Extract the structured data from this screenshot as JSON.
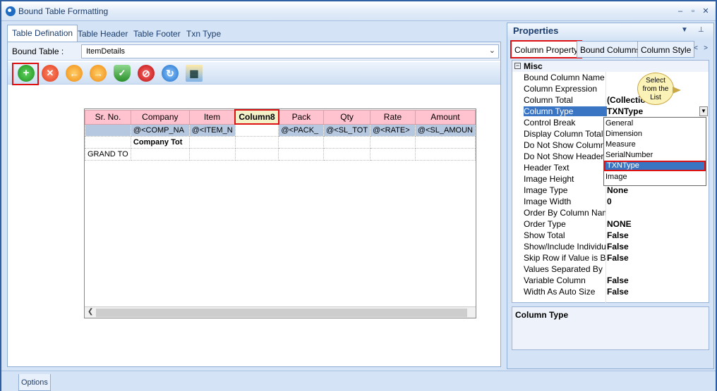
{
  "window": {
    "title": "Bound Table Formatting"
  },
  "tabs": [
    "Table Defination",
    "Table Header",
    "Table Footer",
    "Txn Type"
  ],
  "bound_table": {
    "label": "Bound Table :",
    "value": "ItemDetails"
  },
  "toolbar": {
    "buttons": [
      "add-icon",
      "delete-icon",
      "arrow-left-icon",
      "arrow-right-icon",
      "shield-check-icon",
      "stop-icon",
      "refresh-icon",
      "grid-layout-icon"
    ]
  },
  "grid": {
    "columns": [
      "Sr. No.",
      "Company",
      "Item",
      "Column8",
      "Pack",
      "Qty",
      "Rate",
      "Amount"
    ],
    "rows": [
      [
        "",
        "@<COMP_NA",
        "@<ITEM_N",
        "",
        "@<PACK_",
        "@<SL_TOT",
        "@<RATE>",
        "@<SL_AMOUN"
      ],
      [
        "",
        "Company Tot",
        "",
        "",
        "",
        "",
        "",
        ""
      ],
      [
        "GRAND TO",
        "",
        "",
        "",
        "",
        "",
        "",
        ""
      ]
    ]
  },
  "bottom": {
    "options_label": "Options"
  },
  "properties": {
    "title": "Properties",
    "tabs": [
      "Column Property",
      "Bound Columns",
      "Column Style"
    ],
    "category": "Misc",
    "rows": [
      {
        "name": "Bound Column Name",
        "value": ""
      },
      {
        "name": "Column Expression",
        "value": ""
      },
      {
        "name": "Column Total",
        "value": "(Collectio"
      },
      {
        "name": "Column Type",
        "value": "TXNType"
      },
      {
        "name": "Control Break",
        "value": ""
      },
      {
        "name": "Display Column Total",
        "value": ""
      },
      {
        "name": "Do Not Show Column",
        "value": ""
      },
      {
        "name": "Do Not Show Header C",
        "value": ""
      },
      {
        "name": "Header Text",
        "value": ""
      },
      {
        "name": "Image Height",
        "value": ""
      },
      {
        "name": "Image Type",
        "value": "None"
      },
      {
        "name": "Image Width",
        "value": "0"
      },
      {
        "name": "Order By Column Nam",
        "value": ""
      },
      {
        "name": "Order Type",
        "value": "NONE"
      },
      {
        "name": "Show Total",
        "value": "False"
      },
      {
        "name": "Show/Include Individu",
        "value": "False"
      },
      {
        "name": "Skip Row if Value is Bl",
        "value": "False"
      },
      {
        "name": "Values Separated By",
        "value": ""
      },
      {
        "name": "Variable Column",
        "value": "False"
      },
      {
        "name": "Width As Auto Size",
        "value": "False"
      }
    ],
    "dropdown_options": [
      "General",
      "Dimension",
      "Measure",
      "SerialNumber",
      "TXNType",
      "Image"
    ],
    "callout": {
      "line1": "Select",
      "line2": "from the",
      "line3": "List"
    },
    "description_title": "Column Type"
  }
}
